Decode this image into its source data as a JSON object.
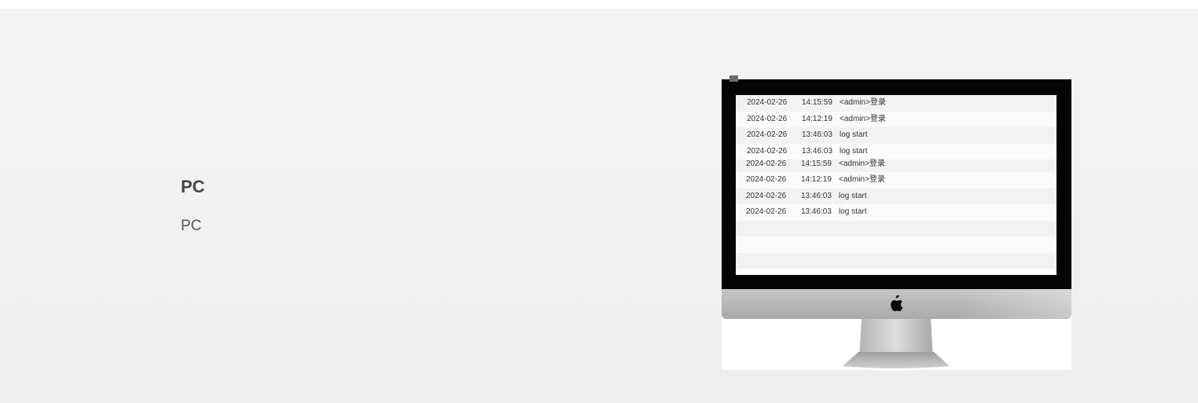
{
  "feature": {
    "title": "PC",
    "description": "PC"
  },
  "log_screen": {
    "group_a": [
      {
        "date": "2024-02-26",
        "time": "14:15:59",
        "message": "<admin>登录"
      },
      {
        "date": "2024-02-26",
        "time": "14:12:19",
        "message": "<admin>登录"
      },
      {
        "date": "2024-02-26",
        "time": "13:46:03",
        "message": "log start"
      },
      {
        "date": "2024-02-26",
        "time": "13:46:03",
        "message": "log start"
      }
    ],
    "group_b": [
      {
        "date": "2024-02-26",
        "time": "14:15:59",
        "message": "<admin>登录"
      },
      {
        "date": "2024-02-26",
        "time": "14:12:19",
        "message": "<admin>登录"
      },
      {
        "date": "2024-02-26",
        "time": "13:46:03",
        "message": "log start"
      },
      {
        "date": "2024-02-26",
        "time": "13:46:03",
        "message": "log start"
      }
    ]
  },
  "colors": {
    "panel_bg": "#f1f1f1",
    "title_text": "#444444",
    "bezel": "#050505",
    "chin": "#b8b9bb"
  },
  "icons": {
    "chin_logo": "apple-logo-icon"
  }
}
